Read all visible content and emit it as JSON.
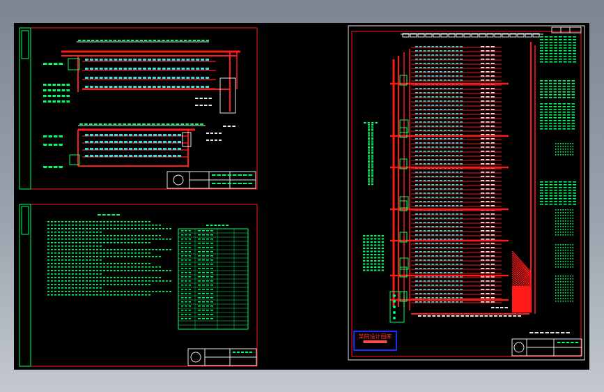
{
  "window": {
    "background_color": "#000000",
    "sheet_border_color": "#ff2020",
    "wire_color": "#ff0000",
    "text_color": "#00ff66"
  },
  "sheets": [
    {
      "id": "single-line-diagram-sheet",
      "content": "electrical single-line diagram"
    },
    {
      "id": "design-notes-sheet",
      "content": "design notes and material table"
    },
    {
      "id": "distribution-system-sheet",
      "content": "large distribution system diagram"
    }
  ],
  "stamp": {
    "title": "某院设计图库",
    "color": "#ff3030",
    "border_color": "#1a2cff"
  }
}
